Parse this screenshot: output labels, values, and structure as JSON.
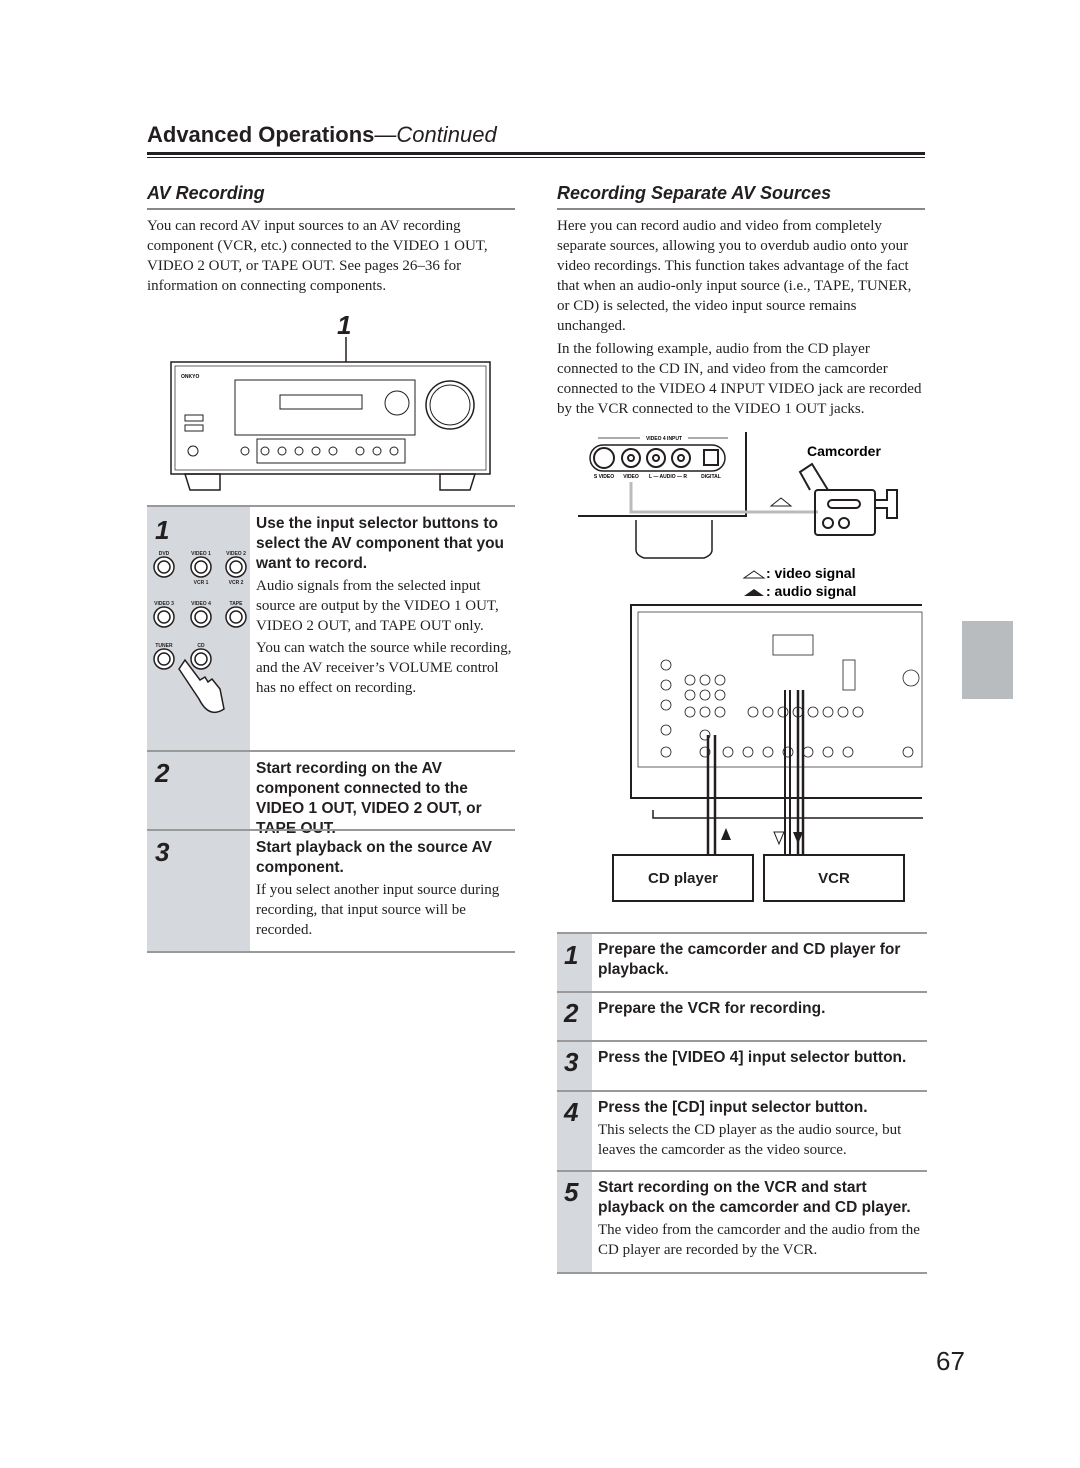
{
  "header": {
    "title": "Advanced Operations",
    "continued": "—Continued"
  },
  "left": {
    "title": "AV Recording",
    "intro": "You can record AV input sources to an AV recording component (VCR, etc.) connected to the VIDEO 1 OUT, VIDEO 2 OUT, or TAPE OUT. See pages 26–36 for information on connecting components.",
    "callout": "1",
    "buttons": [
      "DVD",
      "VIDEO 1",
      "VIDEO 2",
      "VIDEO 3",
      "VIDEO 4",
      "TAPE",
      "TUNER",
      "CD"
    ],
    "button_sublabels": [
      "VCR 1",
      "VCR 2"
    ],
    "steps": [
      {
        "num": "1",
        "heading": "Use the input selector buttons to select the AV component that you want to record.",
        "body": [
          "Audio signals from the selected input source are output by the VIDEO 1 OUT, VIDEO 2 OUT, and TAPE OUT only.",
          "You can watch the source while recording, and the AV receiver’s VOLUME control has no effect on recording."
        ]
      },
      {
        "num": "2",
        "heading": "Start recording on the AV component connected to the VIDEO 1 OUT, VIDEO 2 OUT, or TAPE OUT.",
        "body": []
      },
      {
        "num": "3",
        "heading": "Start playback on the source AV component.",
        "body": [
          "If you select another input source during recording, that input source will be recorded."
        ]
      }
    ]
  },
  "right": {
    "title": "Recording Separate AV Sources",
    "intro1": "Here you can record audio and video from completely separate sources, allowing you to overdub audio onto your video recordings. This function takes advantage of the fact that when an audio-only input source (i.e., TAPE, TUNER, or CD) is selected, the video input source remains unchanged.",
    "intro2": "In the following example, audio from the CD player connected to the CD IN, and video from the camcorder connected to the VIDEO 4 INPUT VIDEO jack are recorded by the VCR connected to the VIDEO 1 OUT jacks.",
    "diagram": {
      "panel_title": "VIDEO 4 INPUT",
      "jacks": [
        "S VIDEO",
        "VIDEO",
        "L — AUDIO — R",
        "DIGITAL"
      ],
      "camcorder": "Camcorder",
      "legend_video": ": video signal",
      "legend_audio": ": audio signal",
      "cd_player": "CD player",
      "vcr": "VCR"
    },
    "steps": [
      {
        "num": "1",
        "heading": "Prepare the camcorder and CD player for playback.",
        "body": ""
      },
      {
        "num": "2",
        "heading": "Prepare the VCR for recording.",
        "body": ""
      },
      {
        "num": "3",
        "heading": "Press the [VIDEO 4] input selector button.",
        "body": ""
      },
      {
        "num": "4",
        "heading": "Press the [CD] input selector button.",
        "body": "This selects the CD player as the audio source, but leaves the camcorder as the video source."
      },
      {
        "num": "5",
        "heading": "Start recording on the VCR and start playback on the camcorder and CD player.",
        "body": "The video from the camcorder and the audio from the CD player are recorded by the VCR."
      }
    ]
  },
  "page_number": "67"
}
